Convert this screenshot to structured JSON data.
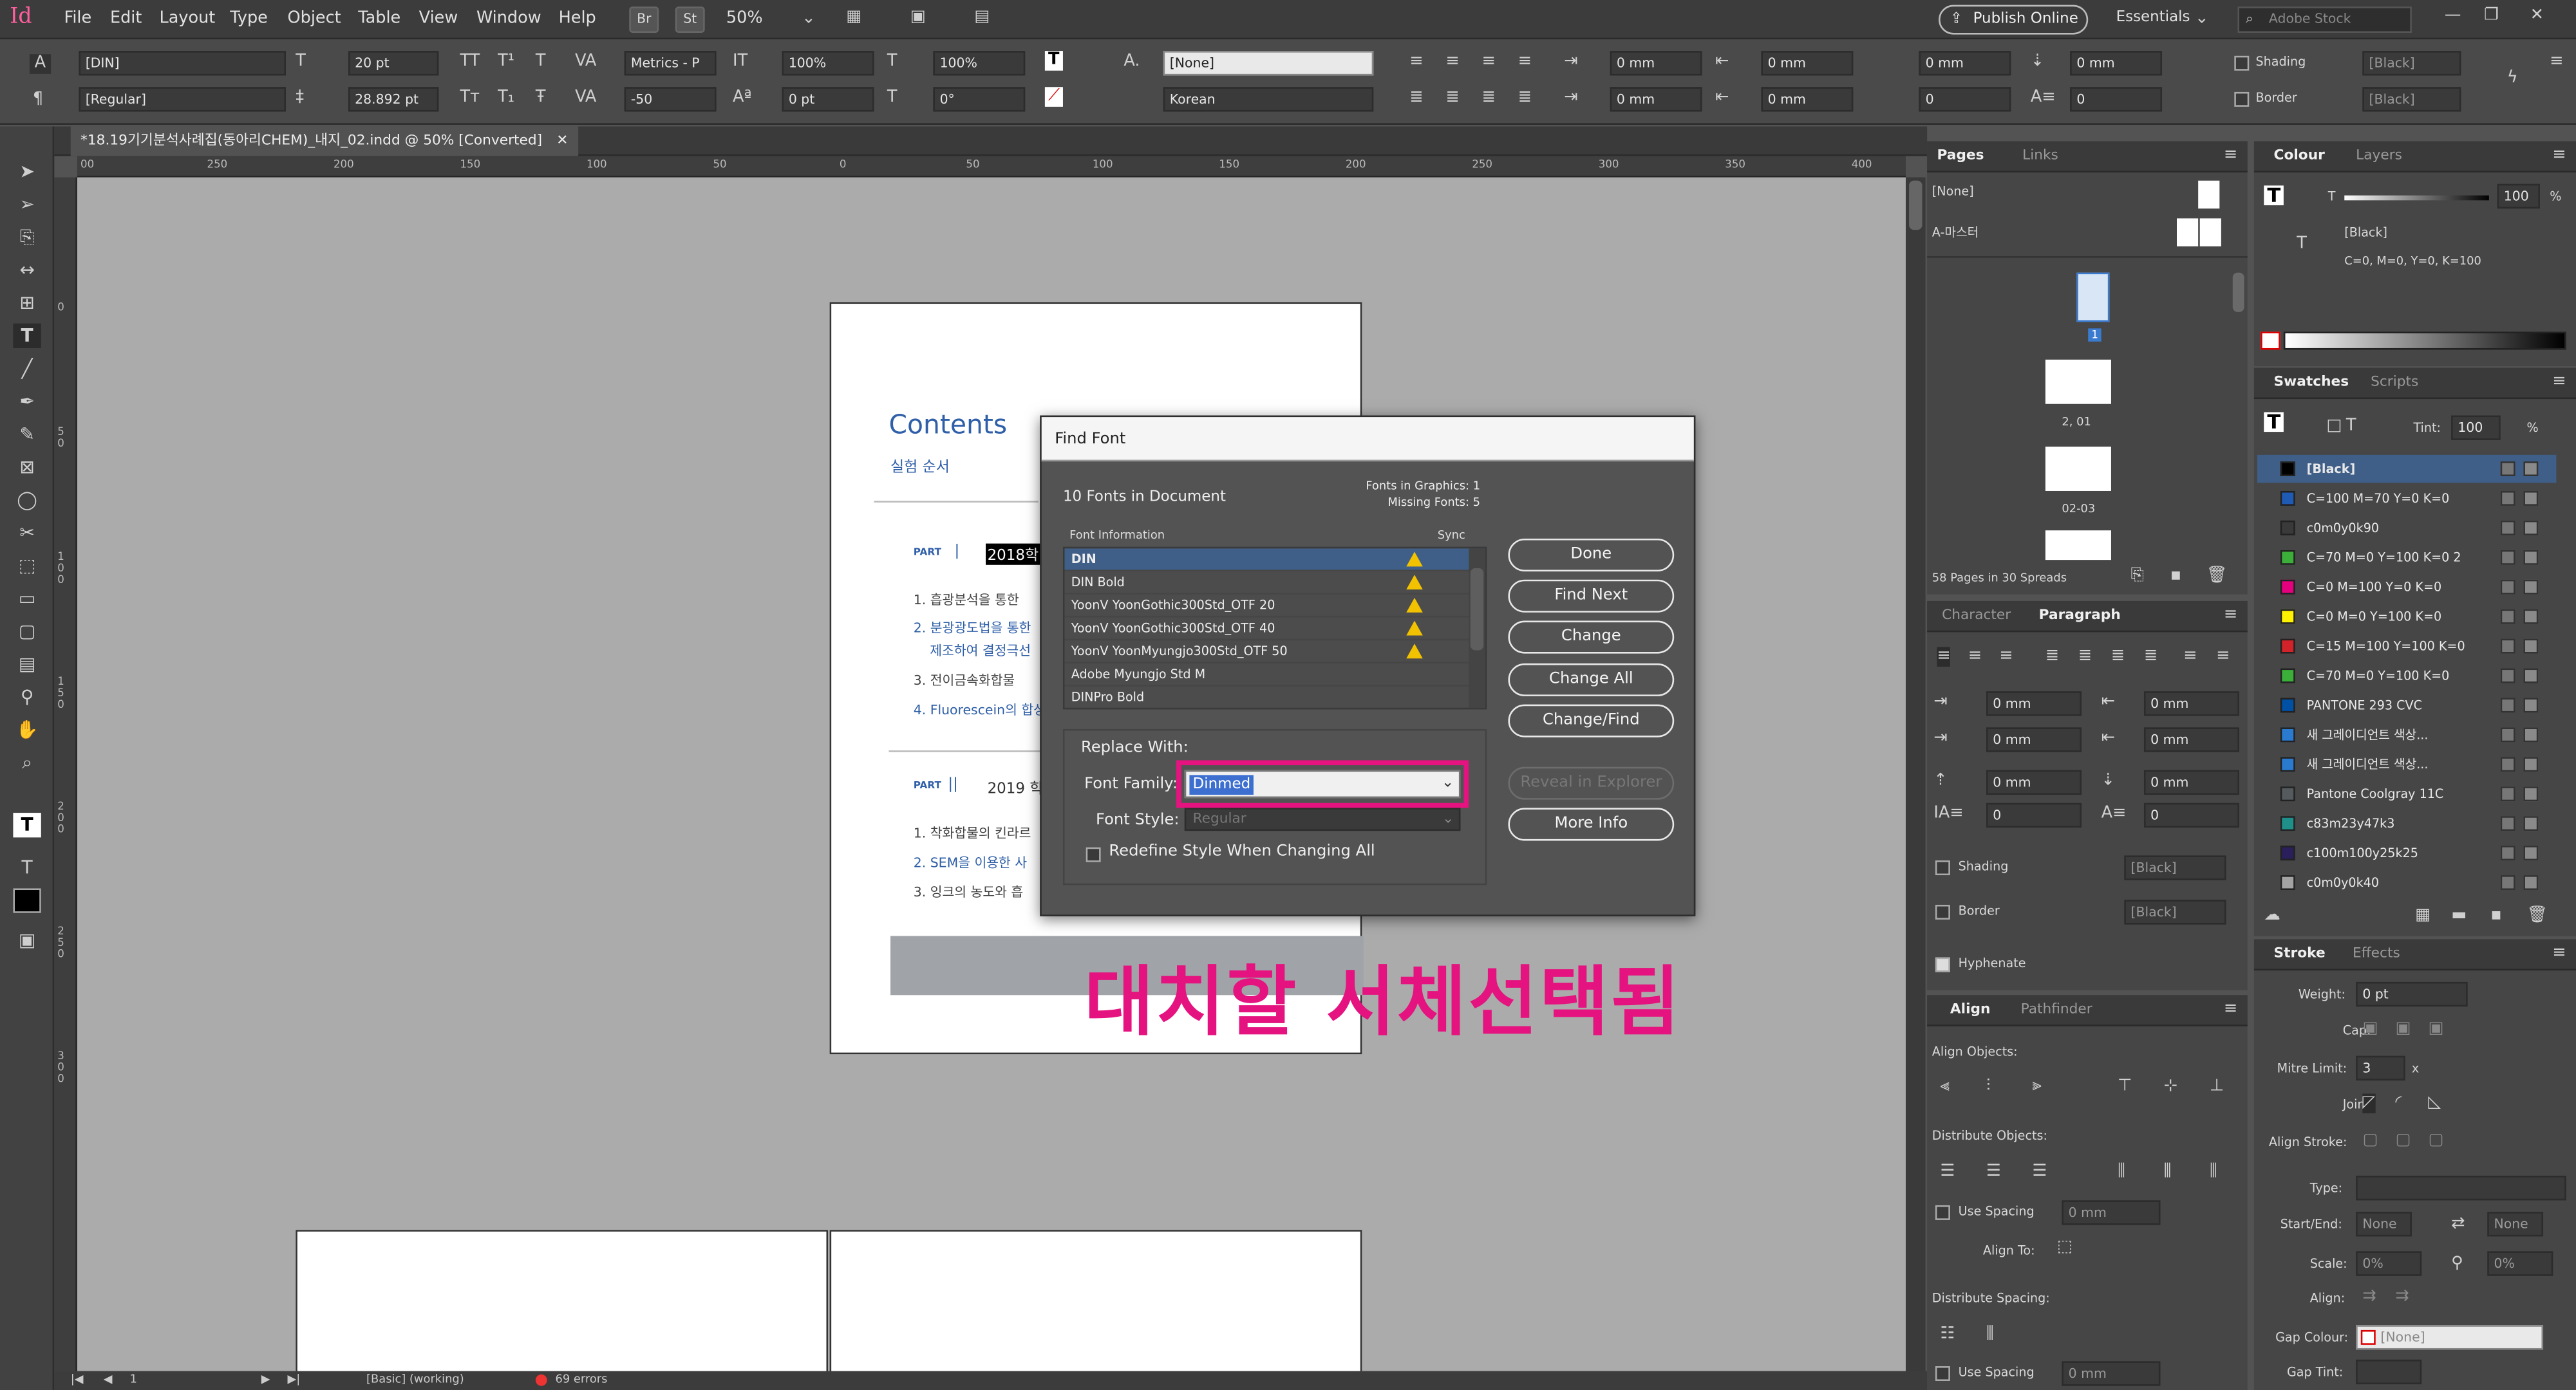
{
  "app": {
    "logo": "Id",
    "menu": [
      "File",
      "Edit",
      "Layout",
      "Type",
      "Object",
      "Table",
      "View",
      "Window",
      "Help"
    ],
    "bridge": "Br",
    "stock_btn": "St",
    "zoom": "50%",
    "publish_online": "Publish Online",
    "workspace": "Essentials",
    "search_placeholder": "Adobe Stock"
  },
  "control": {
    "font_family": "[DIN]",
    "font_style": "[Regular]",
    "font_size": "20 pt",
    "leading": "28.892 pt",
    "kerning": "Metrics - P",
    "tracking": "-50",
    "vscale": "100%",
    "baseline": "0 pt",
    "hscale": "100%",
    "skew": "0°",
    "char_style": "[None]",
    "language": "Korean",
    "indent_left": "0 mm",
    "indent_right": "0 mm",
    "indent_first": "0 mm",
    "indent_last": "0 mm",
    "space_before": "0 mm",
    "space_after": "0 mm",
    "drop_lines": "0",
    "drop_chars": "0",
    "shading_label": "Shading",
    "border_label": "Border",
    "shading_color": "[Black]",
    "border_color": "[Black]"
  },
  "document": {
    "tab_title": "*18.19기기분석사례집(동아리CHEM)_내지_02.indd @ 50% [Converted]",
    "page": {
      "title": "Contents",
      "subtitle": "실험 순서",
      "part1_label": "PART",
      "part1_num": "|",
      "part1_text": "2018학년",
      "items1": [
        "1. 흡광분석을 통한",
        "2. 분광광도법을 통한",
        "제조하여 결정극선",
        "3. 전이금속화합물",
        "4. Fluorescein의 합성"
      ],
      "part2_label": "PART",
      "part2_num": "||",
      "part2_text": "2019 학년",
      "items2": [
        "1. 착화합물의 킨라르",
        "2. SEM을 이용한 사",
        "3. 잉크의 농도와 흡"
      ]
    },
    "ruler_h": [
      "00",
      "250",
      "200",
      "150",
      "100",
      "50",
      "0",
      "50",
      "100",
      "150",
      "200",
      "250",
      "300",
      "350",
      "400"
    ],
    "ruler_v": [
      "0",
      "5 0",
      "1 0 0",
      "1 5 0",
      "2 0 0",
      "2 5 0",
      "3 0 0"
    ]
  },
  "status": {
    "page_num": "1",
    "style": "[Basic] (working)",
    "errors": "69 errors"
  },
  "find_font": {
    "title": "Find Font",
    "fonts_in_doc": "10 Fonts in Document",
    "fonts_in_graphics": "Fonts in Graphics: 1",
    "missing_fonts": "Missing Fonts: 5",
    "col_info": "Font Information",
    "col_sync": "Sync",
    "fonts": [
      {
        "name": "DIN",
        "warn": true,
        "selected": true
      },
      {
        "name": "DIN Bold",
        "warn": true
      },
      {
        "name": "YoonV YoonGothic300Std_OTF 20",
        "warn": true
      },
      {
        "name": "YoonV YoonGothic300Std_OTF 40",
        "warn": true
      },
      {
        "name": "YoonV YoonMyungjo300Std_OTF 50",
        "warn": true
      },
      {
        "name": "Adobe Myungjo Std M",
        "warn": false
      },
      {
        "name": "DINPro Bold",
        "warn": false
      }
    ],
    "replace_with": "Replace With:",
    "font_family_label": "Font Family:",
    "font_family_value": "Dinmed",
    "font_style_label": "Font Style:",
    "font_style_value": "Regular",
    "redefine": "Redefine Style When Changing All",
    "btn_done": "Done",
    "btn_find_next": "Find Next",
    "btn_change": "Change",
    "btn_change_all": "Change All",
    "btn_change_find": "Change/Find",
    "btn_reveal": "Reveal in Explorer",
    "btn_more_info": "More Info"
  },
  "annotation": "대치할 서체선택됨",
  "pages_panel": {
    "tab_pages": "Pages",
    "tab_links": "Links",
    "none": "[None]",
    "master": "A-마스터",
    "thumb_labels": [
      "1",
      "2, 01",
      "02-03"
    ],
    "summary": "58 Pages in 30 Spreads"
  },
  "para_panel": {
    "tab_character": "Character",
    "tab_paragraph": "Paragraph",
    "fields": [
      "0 mm",
      "0 mm",
      "0 mm",
      "0 mm",
      "0 mm",
      "0 mm",
      "0",
      "0"
    ],
    "shading": "Shading",
    "border": "Border",
    "shading_color": "[Black]",
    "border_color": "[Black]",
    "hyphenate": "Hyphenate"
  },
  "align_panel": {
    "tab_align": "Align",
    "tab_pathfinder": "Pathfinder",
    "align_objects": "Align Objects:",
    "distribute_objects": "Distribute Objects:",
    "use_spacing": "Use Spacing",
    "spacing_value": "0 mm",
    "align_to": "Align To:",
    "distribute_spacing": "Distribute Spacing:",
    "use_spacing2": "Use Spacing",
    "spacing_value2": "0 mm"
  },
  "colour_panel": {
    "tab_colour": "Colour",
    "tab_layers": "Layers",
    "tint": "100",
    "percent": "%",
    "name": "[Black]",
    "values": "C=0, M=0, Y=0, K=100"
  },
  "swatches_panel": {
    "tab_swatches": "Swatches",
    "tab_scripts": "Scripts",
    "tint_label": "Tint:",
    "tint": "100",
    "percent": "%",
    "items": [
      {
        "name": "[Black]",
        "color": "#000000"
      },
      {
        "name": "C=100 M=70 Y=0 K=0",
        "color": "#1f5bb5"
      },
      {
        "name": "c0m0y0k90",
        "color": "#3a3a3a"
      },
      {
        "name": "C=70 M=0 Y=100 K=0 2",
        "color": "#3cae3a"
      },
      {
        "name": "C=0 M=100 Y=0 K=0",
        "color": "#e5007e"
      },
      {
        "name": "C=0 M=0 Y=100 K=0",
        "color": "#fff100"
      },
      {
        "name": "C=15 M=100 Y=100 K=0",
        "color": "#d2232a"
      },
      {
        "name": "C=70 M=0 Y=100 K=0",
        "color": "#3cae3a"
      },
      {
        "name": "PANTONE 293 CVC",
        "color": "#0050a4"
      },
      {
        "name": "새 그레이디언트 색상...",
        "color": "#2a7bd0"
      },
      {
        "name": "새 그레이디언트 색상...",
        "color": "#2a7bd0"
      },
      {
        "name": "Pantone Coolgray 11C",
        "color": "#555a5e"
      },
      {
        "name": "c83m23y47k3",
        "color": "#1f8f8a"
      },
      {
        "name": "c100m100y25k25",
        "color": "#2a1f5a"
      },
      {
        "name": "c0m0y0k40",
        "color": "#a3a3a3"
      }
    ]
  },
  "stroke_panel": {
    "tab_stroke": "Stroke",
    "tab_effects": "Effects",
    "weight_label": "Weight:",
    "weight": "0 pt",
    "cap_label": "Cap:",
    "mitre_label": "Mitre Limit:",
    "mitre": "3",
    "mitre_x": "x",
    "join_label": "Join:",
    "align_label": "Align Stroke:",
    "type_label": "Type:",
    "startend_label": "Start/End:",
    "start": "None",
    "end": "None",
    "scale_label": "Scale:",
    "scale1": "0%",
    "scale2": "0%",
    "align2_label": "Align:",
    "gapcolour_label": "Gap Colour:",
    "gapcolour": "[None]",
    "gaptint_label": "Gap Tint:"
  },
  "colors": {
    "accent_pink": "#e4137f",
    "title_blue": "#2f5fa8",
    "dialog_selected": "#3f5f88"
  }
}
